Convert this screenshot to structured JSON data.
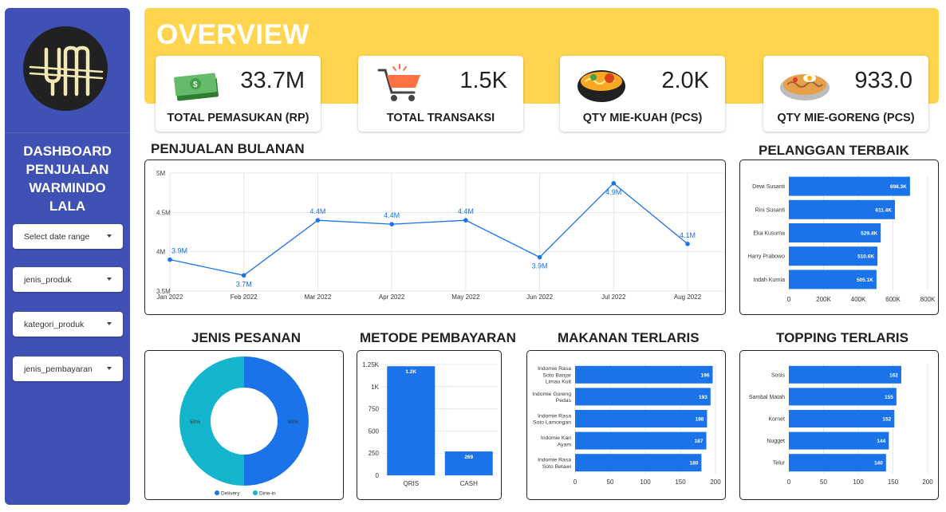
{
  "sidebar": {
    "title": [
      "DASHBOARD",
      "PENJUALAN",
      "WARMINDO",
      "LALA"
    ],
    "filters": [
      {
        "label": "Select date range"
      },
      {
        "label": "jenis_produk"
      },
      {
        "label": "kategori_produk"
      },
      {
        "label": "jenis_pembayaran"
      }
    ]
  },
  "header": {
    "title": "OVERVIEW"
  },
  "kpis": [
    {
      "value": "33.7M",
      "label": "TOTAL PEMASUKAN (RP)",
      "icon": "money-icon"
    },
    {
      "value": "1.5K",
      "label": "TOTAL TRANSAKSI",
      "icon": "cart-icon"
    },
    {
      "value": "2.0K",
      "label": "QTY MIE-KUAH (PCS)",
      "icon": "noodle-soup-icon"
    },
    {
      "value": "933.0",
      "label": "QTY MIE-GORENG (PCS)",
      "icon": "fried-noodle-icon"
    }
  ],
  "sections": {
    "monthly": "PENJUALAN BULANAN",
    "customers": "PELANGGAN TERBAIK",
    "order_type": "JENIS PESANAN",
    "payment": "METODE PEMBAYARAN",
    "food": "MAKANAN TERLARIS",
    "topping": "TOPPING TERLARIS"
  },
  "colors": {
    "bar": "#1a73e8",
    "donut_a": "#1a73e8",
    "donut_b": "#12b5cb",
    "header": "#ffd54f",
    "sidebar": "#3f51b5"
  },
  "chart_data": [
    {
      "id": "monthly",
      "type": "line",
      "categories": [
        "Jan 2022",
        "Feb 2022",
        "Mar 2022",
        "Apr 2022",
        "May 2022",
        "Jun 2022",
        "Jul 2022",
        "Aug 2022"
      ],
      "values": [
        3.9,
        3.7,
        4.4,
        4.35,
        4.4,
        3.93,
        4.87,
        4.1
      ],
      "labels": [
        "3.9M",
        "3.7M",
        "4.4M",
        "4.4M",
        "4.4M",
        "3.9M",
        "4.9M",
        "4.1M"
      ],
      "ylim": [
        3.5,
        5
      ],
      "yticks": [
        {
          "v": 5,
          "t": "5M"
        },
        {
          "v": 4.5,
          "t": "4.5M"
        },
        {
          "v": 4,
          "t": "4M"
        },
        {
          "v": 3.5,
          "t": "3.5M"
        }
      ],
      "grid": true
    },
    {
      "id": "customers",
      "type": "bar",
      "orientation": "horizontal",
      "categories": [
        "Dewi Susanti",
        "Rini Susanti",
        "Eka Kusuma",
        "Harry Prabowo",
        "Indah Kurnia"
      ],
      "values": [
        698300,
        611400,
        529400,
        510600,
        505100
      ],
      "labels": [
        "698.3K",
        "611.4K",
        "529.4K",
        "510.6K",
        "505.1K"
      ],
      "xlim": [
        0,
        800000
      ],
      "xticks": [
        {
          "v": 0,
          "t": "0"
        },
        {
          "v": 200000,
          "t": "200K"
        },
        {
          "v": 400000,
          "t": "400K"
        },
        {
          "v": 600000,
          "t": "600K"
        },
        {
          "v": 800000,
          "t": "800K"
        }
      ]
    },
    {
      "id": "order_type",
      "type": "pie",
      "categories": [
        "Delivery",
        "Dine-in"
      ],
      "values": [
        50,
        50
      ],
      "labels": [
        "50%",
        "50%"
      ],
      "legend": "bottom"
    },
    {
      "id": "payment",
      "type": "bar",
      "orientation": "vertical",
      "categories": [
        "QRIS",
        "CASH"
      ],
      "values": [
        1230,
        269
      ],
      "labels": [
        "1.2K",
        "269"
      ],
      "ylim": [
        0,
        1250
      ],
      "yticks": [
        {
          "v": 0,
          "t": "0"
        },
        {
          "v": 250,
          "t": "250"
        },
        {
          "v": 500,
          "t": "500"
        },
        {
          "v": 750,
          "t": "750"
        },
        {
          "v": 1000,
          "t": "1K"
        },
        {
          "v": 1250,
          "t": "1.25K"
        }
      ]
    },
    {
      "id": "food",
      "type": "bar",
      "orientation": "horizontal",
      "categories": [
        [
          "Indomie Rasa",
          "Soto Banjar",
          "Limau Kuit"
        ],
        [
          "Indomie Goreng",
          "Pedas"
        ],
        [
          "Indomie Rasa",
          "Soto Lamongan"
        ],
        [
          "Indomie Kari",
          "Ayam"
        ],
        [
          "Indomie Rasa",
          "Soto Betawi"
        ]
      ],
      "values": [
        196,
        193,
        188,
        187,
        180
      ],
      "labels": [
        "196",
        "193",
        "188",
        "187",
        "180"
      ],
      "xlim": [
        0,
        200
      ],
      "xticks": [
        {
          "v": 0,
          "t": "0"
        },
        {
          "v": 50,
          "t": "50"
        },
        {
          "v": 100,
          "t": "100"
        },
        {
          "v": 150,
          "t": "150"
        },
        {
          "v": 200,
          "t": "200"
        }
      ]
    },
    {
      "id": "topping",
      "type": "bar",
      "orientation": "horizontal",
      "categories": [
        "Sosis",
        "Sambal Matah",
        "Kornet",
        "Nugget",
        "Telur"
      ],
      "values": [
        162,
        155,
        152,
        144,
        140
      ],
      "labels": [
        "162",
        "155",
        "152",
        "144",
        "140"
      ],
      "xlim": [
        0,
        200
      ],
      "xticks": [
        {
          "v": 0,
          "t": "0"
        },
        {
          "v": 50,
          "t": "50"
        },
        {
          "v": 100,
          "t": "100"
        },
        {
          "v": 150,
          "t": "150"
        },
        {
          "v": 200,
          "t": "200"
        }
      ]
    }
  ]
}
